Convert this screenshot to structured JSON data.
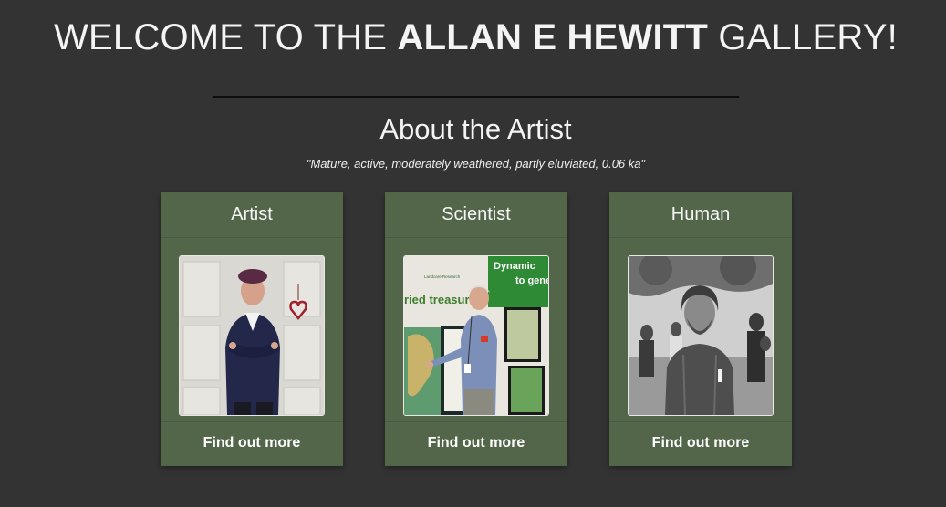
{
  "header": {
    "title_prefix": "WELCOME TO THE ",
    "title_name": "ALLAN E HEWITT",
    "title_suffix": " GALLERY!"
  },
  "about": {
    "heading": "About the Artist",
    "quote": "\"Mature, active, moderately weathered, partly eluviated, 0.06 ka\""
  },
  "cards": [
    {
      "title": "Artist",
      "image_alt": "Man in purple beret with crossed arms in front of white door",
      "link_label": "Find out more"
    },
    {
      "title": "Scientist",
      "image_alt": "Man pointing at a soil map on a display board",
      "link_label": "Find out more"
    },
    {
      "title": "Human",
      "image_alt": "Black and white photo of a young bearded man outdoors",
      "link_label": "Find out more"
    }
  ],
  "poster_text": {
    "banner": "Dynamic",
    "banner2": "to gener",
    "headline": "ried treasure",
    "org": "Landcare Research"
  },
  "colors": {
    "background": "#333333",
    "card": "#53664a",
    "divider": "#0d0d0d"
  }
}
